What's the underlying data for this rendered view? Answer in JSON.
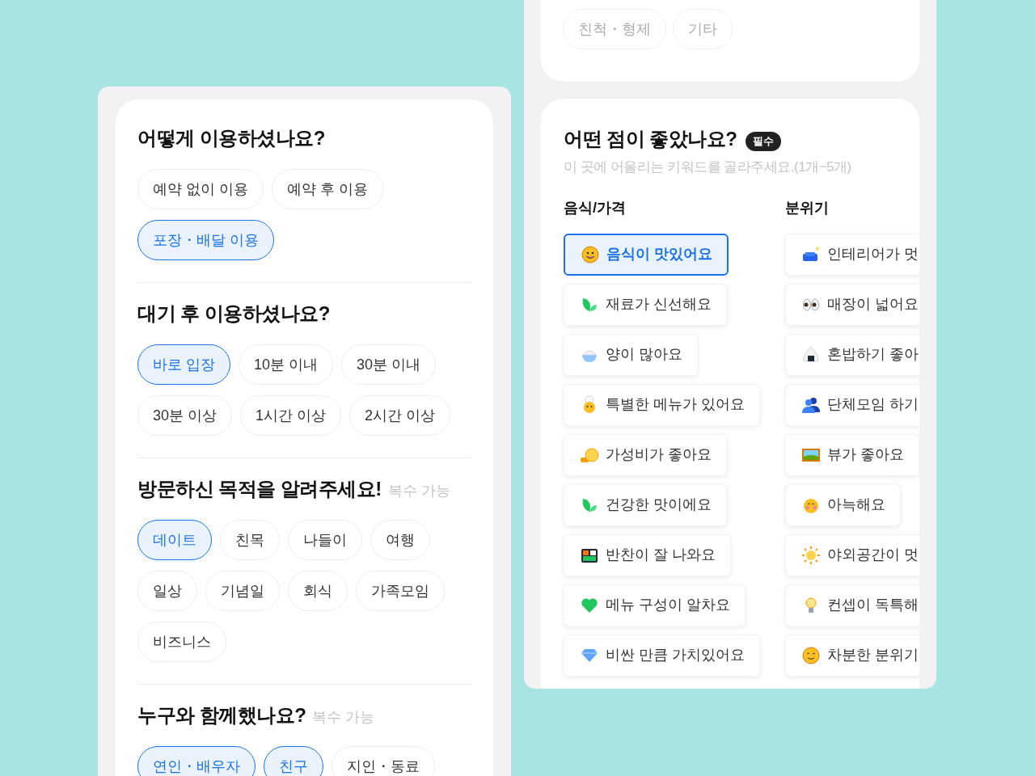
{
  "left_panel": {
    "sections": [
      {
        "title": "어떻게 이용하셨나요?",
        "options": [
          {
            "label": "예약 없이 이용",
            "selected": false
          },
          {
            "label": "예약 후 이용",
            "selected": false
          },
          {
            "label": "포장・배달 이용",
            "selected": true
          }
        ]
      },
      {
        "title": "대기 후 이용하셨나요?",
        "options": [
          {
            "label": "바로 입장",
            "selected": true
          },
          {
            "label": "10분 이내",
            "selected": false
          },
          {
            "label": "30분 이내",
            "selected": false
          },
          {
            "label": "30분 이상",
            "selected": false
          },
          {
            "label": "1시간 이상",
            "selected": false
          },
          {
            "label": "2시간 이상",
            "selected": false
          }
        ]
      },
      {
        "title": "방문하신 목적을 알려주세요!",
        "note": "복수 가능",
        "options": [
          {
            "label": "데이트",
            "selected": true
          },
          {
            "label": "친목",
            "selected": false
          },
          {
            "label": "나들이",
            "selected": false
          },
          {
            "label": "여행",
            "selected": false
          },
          {
            "label": "일상",
            "selected": false
          },
          {
            "label": "기념일",
            "selected": false
          },
          {
            "label": "회식",
            "selected": false
          },
          {
            "label": "가족모임",
            "selected": false
          },
          {
            "label": "비즈니스",
            "selected": false
          }
        ]
      },
      {
        "title": "누구와 함께했나요?",
        "note": "복수 가능",
        "options": [
          {
            "label": "연인・배우자",
            "selected": true
          },
          {
            "label": "친구",
            "selected": true
          },
          {
            "label": "지인・동료",
            "selected": false
          }
        ]
      }
    ]
  },
  "right_panel": {
    "top_options": [
      {
        "label": "친척・형제",
        "selected": false
      },
      {
        "label": "기타",
        "selected": false
      }
    ],
    "question": {
      "title": "어떤 점이 좋았나요?",
      "badge": "필수",
      "subtitle": "이 곳에 어울리는 키워드를 골라주세요.(1개~5개)",
      "columns": [
        {
          "heading": "음식/가격",
          "keywords": [
            {
              "label": "음식이 맛있어요",
              "kind": "smile",
              "selected": true
            },
            {
              "label": "재료가 신선해요",
              "kind": "leaf",
              "selected": false
            },
            {
              "label": "양이 많아요",
              "kind": "rice",
              "selected": false
            },
            {
              "label": "특별한 메뉴가 있어요",
              "kind": "chef",
              "selected": false
            },
            {
              "label": "가성비가 좋아요",
              "kind": "coin",
              "selected": false
            },
            {
              "label": "건강한 맛이에요",
              "kind": "leaf",
              "selected": false
            },
            {
              "label": "반찬이 잘 나와요",
              "kind": "bento",
              "selected": false
            },
            {
              "label": "메뉴 구성이 알차요",
              "kind": "heart",
              "selected": false
            },
            {
              "label": "비싼 만큼 가치있어요",
              "kind": "gem",
              "selected": false
            }
          ]
        },
        {
          "heading": "분위기",
          "keywords": [
            {
              "label": "인테리어가 멋",
              "kind": "sofa",
              "selected": false
            },
            {
              "label": "매장이 넓어요",
              "kind": "eyes",
              "selected": false
            },
            {
              "label": "혼밥하기 좋아",
              "kind": "riceball",
              "selected": false
            },
            {
              "label": "단체모임 하기",
              "kind": "people",
              "selected": false
            },
            {
              "label": "뷰가 좋아요",
              "kind": "picture",
              "selected": false
            },
            {
              "label": "아늑해요",
              "kind": "blush",
              "selected": false
            },
            {
              "label": "야외공간이 멋",
              "kind": "sun",
              "selected": false
            },
            {
              "label": "컨셉이 독특해",
              "kind": "bulb",
              "selected": false
            },
            {
              "label": "차분한 분위기",
              "kind": "calm",
              "selected": false
            }
          ]
        }
      ]
    }
  }
}
